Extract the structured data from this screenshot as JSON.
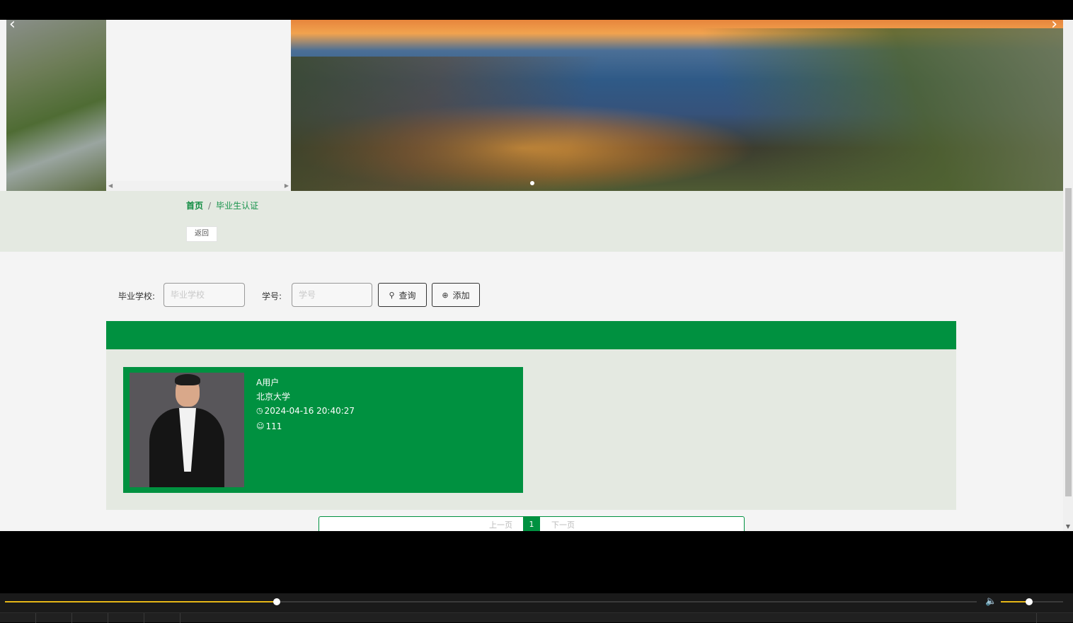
{
  "breadcrumb": {
    "home": "首页",
    "separator": "/",
    "current": "毕业生认证"
  },
  "back_button": "返回",
  "search": {
    "school_label": "毕业学校:",
    "school_placeholder": "毕业学校",
    "id_label": "学号:",
    "id_placeholder": "学号",
    "query_button": "查询",
    "add_button": "添加"
  },
  "cards": [
    {
      "name": "A用户",
      "school": "北京大学",
      "time": "2024-04-16 20:40:27",
      "student_id": "111"
    }
  ],
  "pagination": {
    "prev": "上一页",
    "current": "1",
    "next": "下一页"
  },
  "player": {
    "progress_fraction": 0.28,
    "volume_fraction": 0.45
  },
  "colors": {
    "brand_green": "#009140",
    "band_bg": "#e4e9e1",
    "player_accent": "#e5b617"
  },
  "icons": {
    "carousel_prev": "chevron-left-icon",
    "carousel_next": "chevron-right-icon",
    "query": "search-icon",
    "add": "plus-circle-icon",
    "time": "clock-icon",
    "user": "user-icon",
    "volume": "volume-icon"
  }
}
